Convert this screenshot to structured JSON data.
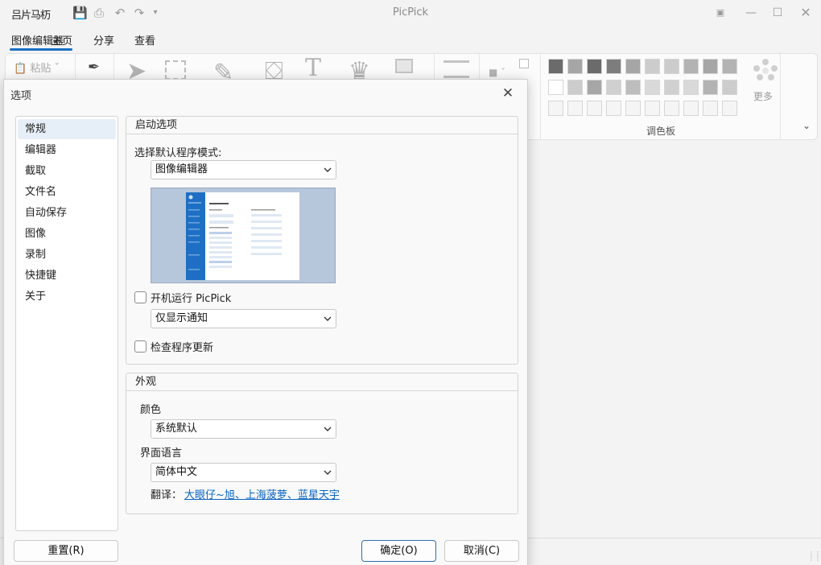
{
  "app": {
    "logo_text": "吕片马杤",
    "window_title": "PicPick",
    "tabs": [
      "图像编辑器",
      "主页",
      "分享",
      "查看"
    ],
    "ribbon": {
      "paste_label": "粘贴",
      "palette_label": "调色板",
      "more_label": "更多"
    },
    "palette_colors": [
      [
        "#6b6b6b",
        "#a6a6a6",
        "#6b6b6b",
        "#7d7d7d",
        "#a6a6a6",
        "#cccccc",
        "#cccccc",
        "#b3b3b3",
        "#a6a6a6",
        "#b3b3b3"
      ],
      [
        "#ffffff",
        "#cccccc",
        "#a6a6a6",
        "#d0d0d0",
        "#bdbdbd",
        "#d9d9d9",
        "#d0d0d0",
        "#d9d9d9",
        "#b3b3b3",
        "#cccccc"
      ],
      [
        "#f5f5f5",
        "#f5f5f5",
        "#f5f5f5",
        "#f5f5f5",
        "#f5f5f5",
        "#f5f5f5",
        "#f5f5f5",
        "#f5f5f5",
        "#f5f5f5",
        "#f5f5f5"
      ]
    ]
  },
  "dialog": {
    "title": "选项",
    "nav": [
      "常规",
      "编辑器",
      "截取",
      "文件名",
      "自动保存",
      "图像",
      "录制",
      "快捷键",
      "关于"
    ],
    "startup": {
      "group_title": "启动选项",
      "mode_label": "选择默认程序模式:",
      "mode_value": "图像编辑器",
      "run_at_startup_label": "开机运行 PicPick",
      "run_at_startup_checked": false,
      "startup_option_value": "仅显示通知",
      "check_updates_label": "检查程序更新",
      "check_updates_checked": false
    },
    "appearance": {
      "group_title": "外观",
      "color_label": "颜色",
      "color_value": "系统默认",
      "language_label": "界面语言",
      "language_value": "简体中文",
      "translation_prefix": "翻译：",
      "translation_credits": "大眼仔~旭、上海菠萝、蓝星天宇"
    },
    "buttons": {
      "reset": "重置(R)",
      "ok": "确定(O)",
      "cancel": "取消(C)"
    }
  }
}
